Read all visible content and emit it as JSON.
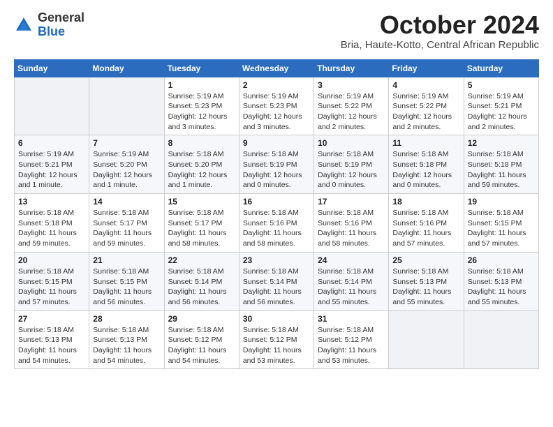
{
  "header": {
    "logo_general": "General",
    "logo_blue": "Blue",
    "month_title": "October 2024",
    "subtitle": "Bria, Haute-Kotto, Central African Republic"
  },
  "weekdays": [
    "Sunday",
    "Monday",
    "Tuesday",
    "Wednesday",
    "Thursday",
    "Friday",
    "Saturday"
  ],
  "weeks": [
    [
      {
        "day": "",
        "info": ""
      },
      {
        "day": "",
        "info": ""
      },
      {
        "day": "1",
        "info": "Sunrise: 5:19 AM\nSunset: 5:23 PM\nDaylight: 12 hours and 3 minutes."
      },
      {
        "day": "2",
        "info": "Sunrise: 5:19 AM\nSunset: 5:23 PM\nDaylight: 12 hours and 3 minutes."
      },
      {
        "day": "3",
        "info": "Sunrise: 5:19 AM\nSunset: 5:22 PM\nDaylight: 12 hours and 2 minutes."
      },
      {
        "day": "4",
        "info": "Sunrise: 5:19 AM\nSunset: 5:22 PM\nDaylight: 12 hours and 2 minutes."
      },
      {
        "day": "5",
        "info": "Sunrise: 5:19 AM\nSunset: 5:21 PM\nDaylight: 12 hours and 2 minutes."
      }
    ],
    [
      {
        "day": "6",
        "info": "Sunrise: 5:19 AM\nSunset: 5:21 PM\nDaylight: 12 hours and 1 minute."
      },
      {
        "day": "7",
        "info": "Sunrise: 5:19 AM\nSunset: 5:20 PM\nDaylight: 12 hours and 1 minute."
      },
      {
        "day": "8",
        "info": "Sunrise: 5:18 AM\nSunset: 5:20 PM\nDaylight: 12 hours and 1 minute."
      },
      {
        "day": "9",
        "info": "Sunrise: 5:18 AM\nSunset: 5:19 PM\nDaylight: 12 hours and 0 minutes."
      },
      {
        "day": "10",
        "info": "Sunrise: 5:18 AM\nSunset: 5:19 PM\nDaylight: 12 hours and 0 minutes."
      },
      {
        "day": "11",
        "info": "Sunrise: 5:18 AM\nSunset: 5:18 PM\nDaylight: 12 hours and 0 minutes."
      },
      {
        "day": "12",
        "info": "Sunrise: 5:18 AM\nSunset: 5:18 PM\nDaylight: 11 hours and 59 minutes."
      }
    ],
    [
      {
        "day": "13",
        "info": "Sunrise: 5:18 AM\nSunset: 5:18 PM\nDaylight: 11 hours and 59 minutes."
      },
      {
        "day": "14",
        "info": "Sunrise: 5:18 AM\nSunset: 5:17 PM\nDaylight: 11 hours and 59 minutes."
      },
      {
        "day": "15",
        "info": "Sunrise: 5:18 AM\nSunset: 5:17 PM\nDaylight: 11 hours and 58 minutes."
      },
      {
        "day": "16",
        "info": "Sunrise: 5:18 AM\nSunset: 5:16 PM\nDaylight: 11 hours and 58 minutes."
      },
      {
        "day": "17",
        "info": "Sunrise: 5:18 AM\nSunset: 5:16 PM\nDaylight: 11 hours and 58 minutes."
      },
      {
        "day": "18",
        "info": "Sunrise: 5:18 AM\nSunset: 5:16 PM\nDaylight: 11 hours and 57 minutes."
      },
      {
        "day": "19",
        "info": "Sunrise: 5:18 AM\nSunset: 5:15 PM\nDaylight: 11 hours and 57 minutes."
      }
    ],
    [
      {
        "day": "20",
        "info": "Sunrise: 5:18 AM\nSunset: 5:15 PM\nDaylight: 11 hours and 57 minutes."
      },
      {
        "day": "21",
        "info": "Sunrise: 5:18 AM\nSunset: 5:15 PM\nDaylight: 11 hours and 56 minutes."
      },
      {
        "day": "22",
        "info": "Sunrise: 5:18 AM\nSunset: 5:14 PM\nDaylight: 11 hours and 56 minutes."
      },
      {
        "day": "23",
        "info": "Sunrise: 5:18 AM\nSunset: 5:14 PM\nDaylight: 11 hours and 56 minutes."
      },
      {
        "day": "24",
        "info": "Sunrise: 5:18 AM\nSunset: 5:14 PM\nDaylight: 11 hours and 55 minutes."
      },
      {
        "day": "25",
        "info": "Sunrise: 5:18 AM\nSunset: 5:13 PM\nDaylight: 11 hours and 55 minutes."
      },
      {
        "day": "26",
        "info": "Sunrise: 5:18 AM\nSunset: 5:13 PM\nDaylight: 11 hours and 55 minutes."
      }
    ],
    [
      {
        "day": "27",
        "info": "Sunrise: 5:18 AM\nSunset: 5:13 PM\nDaylight: 11 hours and 54 minutes."
      },
      {
        "day": "28",
        "info": "Sunrise: 5:18 AM\nSunset: 5:13 PM\nDaylight: 11 hours and 54 minutes."
      },
      {
        "day": "29",
        "info": "Sunrise: 5:18 AM\nSunset: 5:12 PM\nDaylight: 11 hours and 54 minutes."
      },
      {
        "day": "30",
        "info": "Sunrise: 5:18 AM\nSunset: 5:12 PM\nDaylight: 11 hours and 53 minutes."
      },
      {
        "day": "31",
        "info": "Sunrise: 5:18 AM\nSunset: 5:12 PM\nDaylight: 11 hours and 53 minutes."
      },
      {
        "day": "",
        "info": ""
      },
      {
        "day": "",
        "info": ""
      }
    ]
  ]
}
